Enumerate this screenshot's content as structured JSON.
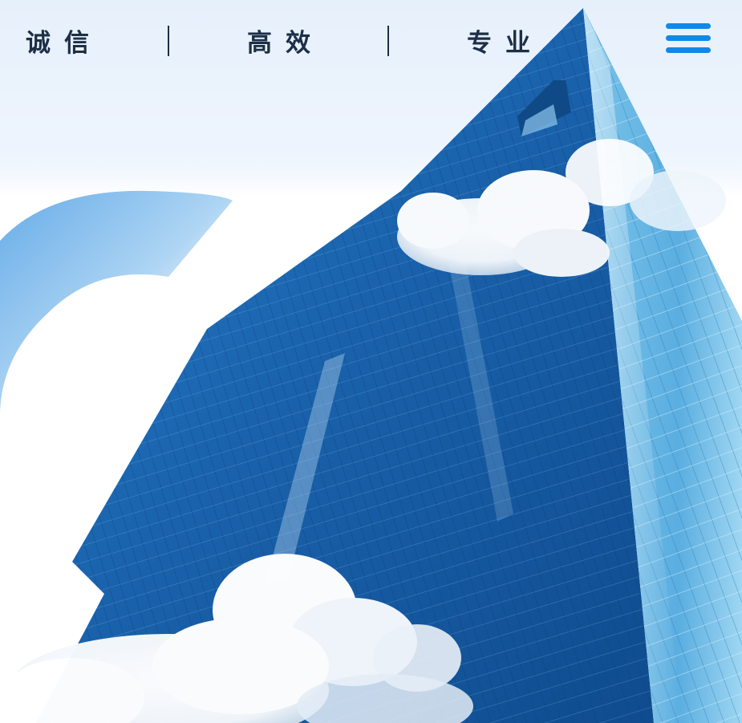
{
  "header": {
    "slogan": [
      "诚信",
      "高效",
      "专业"
    ],
    "separator": "|",
    "menu_icon": "hamburger-menu-icon"
  },
  "hero": {
    "image": "glass-skyscraper-with-clouds"
  },
  "colors": {
    "slogan_text": "#1d2f46",
    "menu_accent": "#1188e8",
    "header_bg": "#e8f1fc",
    "glass_blue": "#1f6fb8"
  }
}
